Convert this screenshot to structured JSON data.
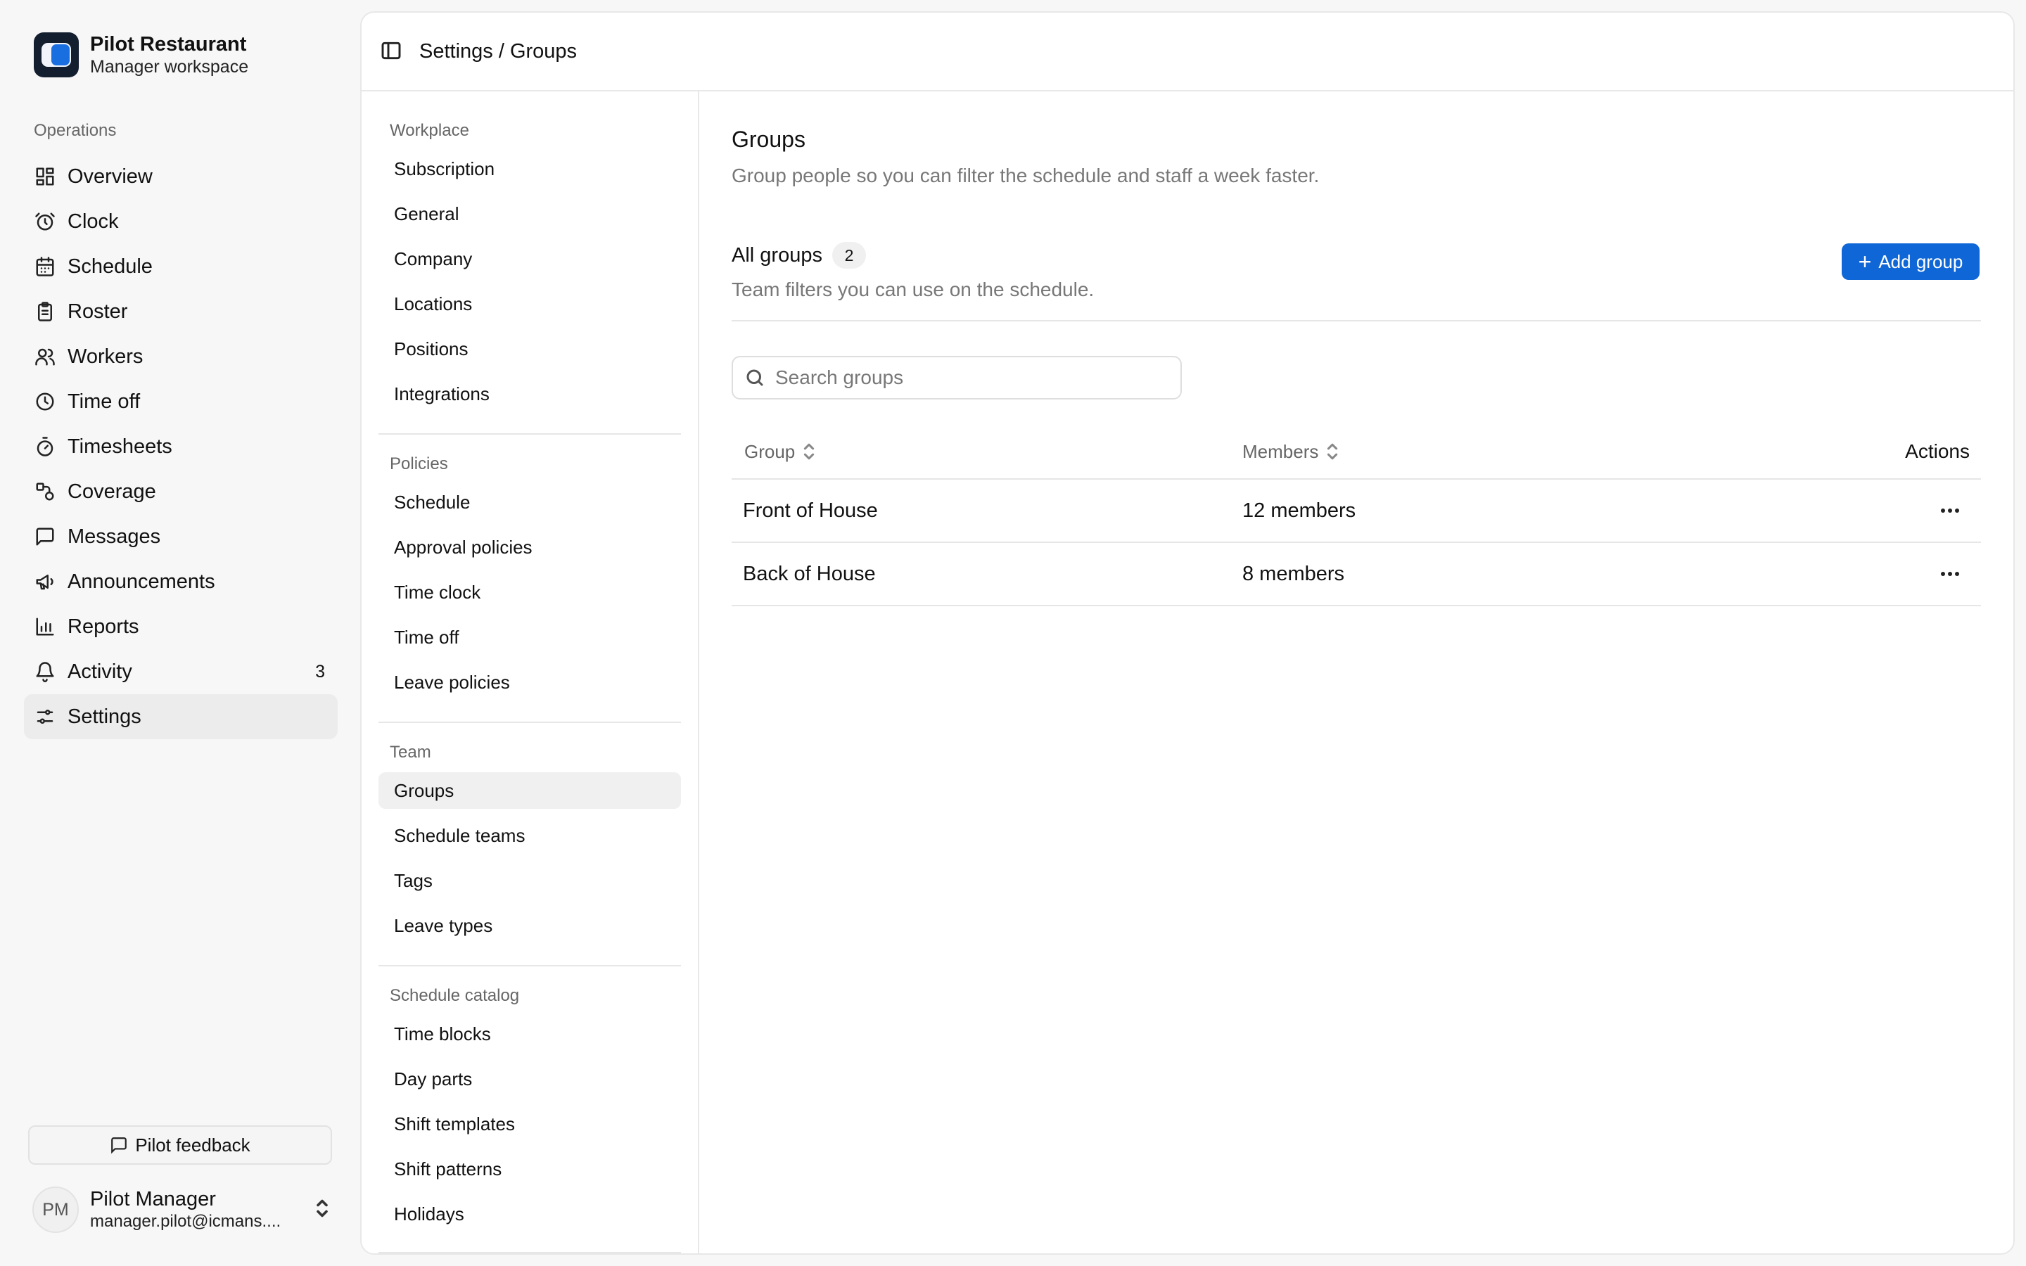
{
  "brand": {
    "name": "Pilot Restaurant",
    "subtitle": "Manager workspace"
  },
  "sidebar": {
    "section_label": "Operations",
    "items": [
      {
        "label": "Overview",
        "icon": "grid-icon"
      },
      {
        "label": "Clock",
        "icon": "alarm-clock-icon"
      },
      {
        "label": "Schedule",
        "icon": "calendar-icon"
      },
      {
        "label": "Roster",
        "icon": "clipboard-icon"
      },
      {
        "label": "Workers",
        "icon": "users-icon"
      },
      {
        "label": "Time off",
        "icon": "clock-icon"
      },
      {
        "label": "Timesheets",
        "icon": "stopwatch-icon"
      },
      {
        "label": "Coverage",
        "icon": "shapes-icon"
      },
      {
        "label": "Messages",
        "icon": "message-icon"
      },
      {
        "label": "Announcements",
        "icon": "megaphone-icon"
      },
      {
        "label": "Reports",
        "icon": "bar-chart-icon"
      },
      {
        "label": "Activity",
        "icon": "bell-icon",
        "badge": "3"
      },
      {
        "label": "Settings",
        "icon": "sliders-icon",
        "active": true
      }
    ],
    "feedback_label": "Pilot feedback",
    "user": {
      "initials": "PM",
      "name": "Pilot Manager",
      "email": "manager.pilot@icmans...."
    }
  },
  "topbar": {
    "breadcrumb": "Settings / Groups"
  },
  "subnav": {
    "groups": [
      {
        "label": "Workplace",
        "items": [
          "Subscription",
          "General",
          "Company",
          "Locations",
          "Positions",
          "Integrations"
        ]
      },
      {
        "label": "Policies",
        "items": [
          "Schedule",
          "Approval policies",
          "Time clock",
          "Time off",
          "Leave policies"
        ]
      },
      {
        "label": "Team",
        "items": [
          "Groups",
          "Schedule teams",
          "Tags",
          "Leave types"
        ]
      },
      {
        "label": "Schedule catalog",
        "items": [
          "Time blocks",
          "Day parts",
          "Shift templates",
          "Shift patterns",
          "Holidays"
        ]
      }
    ],
    "active_item": "Groups"
  },
  "main": {
    "title": "Groups",
    "description": "Group people so you can filter the schedule and staff a week faster.",
    "card": {
      "title": "All groups",
      "count": "2",
      "description": "Team filters you can use on the schedule.",
      "add_label": "Add group"
    },
    "search": {
      "placeholder": "Search groups",
      "value": ""
    },
    "table": {
      "columns": [
        "Group",
        "Members",
        "Actions"
      ],
      "rows": [
        {
          "group": "Front of House",
          "members": "12 members"
        },
        {
          "group": "Back of House",
          "members": "8 members"
        }
      ]
    }
  },
  "colors": {
    "accent": "#0f66d6",
    "brand_dark": "#131e2f",
    "active_bg": "#ececec"
  }
}
